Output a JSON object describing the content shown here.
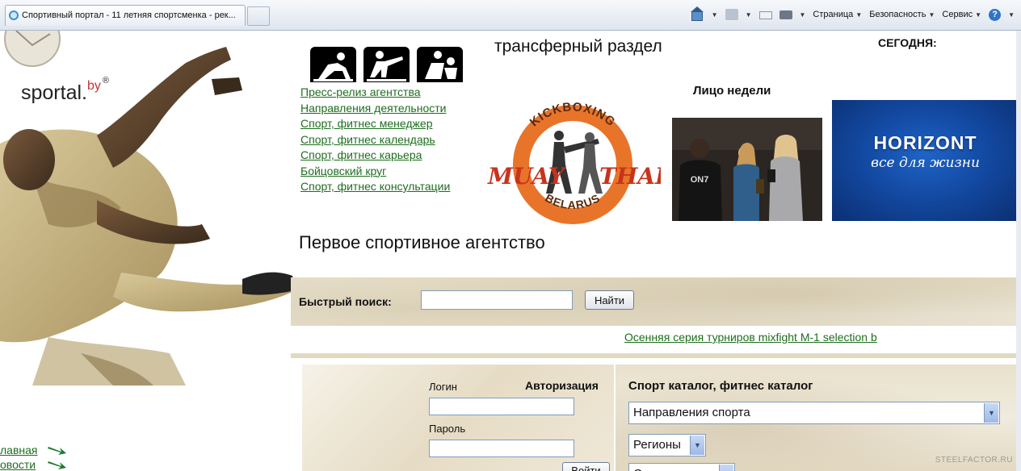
{
  "browser": {
    "tab_title": "Спортивный портал - 11 летняя спортсменка - рек...",
    "toolbar": {
      "page_menu": "Страница",
      "security_menu": "Безопасность",
      "service_menu": "Сервис"
    }
  },
  "header": {
    "logo_text": "sportal.",
    "logo_suffix": "by",
    "logo_mark": "®",
    "transfer_title": "трансферный раздел",
    "today_label": "СЕГОДНЯ:"
  },
  "menu": {
    "items": [
      "Пресс-релиз агентства",
      "Направления деятельности",
      "Спорт, фитнес менеджер",
      "Спорт, фитнес календарь",
      "Спорт, фитнес карьера",
      "Бойцовский круг",
      "Спорт, фитнес консультации"
    ]
  },
  "kickboxing_logo": {
    "top": "KICKBOXING",
    "left": "MUAY",
    "right": "THAI",
    "bottom": "BELARUS"
  },
  "face_of_week": {
    "title": "Лицо недели",
    "shirt_text": "ON7"
  },
  "banner": {
    "brand": "HORIZONT",
    "tagline": "все для жизни"
  },
  "agency_title": "Первое спортивное агентство",
  "search": {
    "label": "Быстрый поиск:",
    "value": "",
    "button": "Найти"
  },
  "ticker": {
    "text": "Осенняя серия турниров mixfight M-1 selection b"
  },
  "auth": {
    "title": "Авторизация",
    "login_label": "Логин",
    "password_label": "Пароль",
    "button": "Войти"
  },
  "catalog": {
    "title": "Спорт каталог, фитнес каталог",
    "directions_select": "Направления спорта",
    "regions_select": "Регионы",
    "third_select": "С"
  },
  "left_links": [
    "лавная",
    "овости"
  ],
  "watermark": "STEELFACTOR.RU",
  "colors": {
    "link_green": "#1d6e1d",
    "banner_blue": "#134aa3",
    "logo_orange": "#e8742a"
  }
}
